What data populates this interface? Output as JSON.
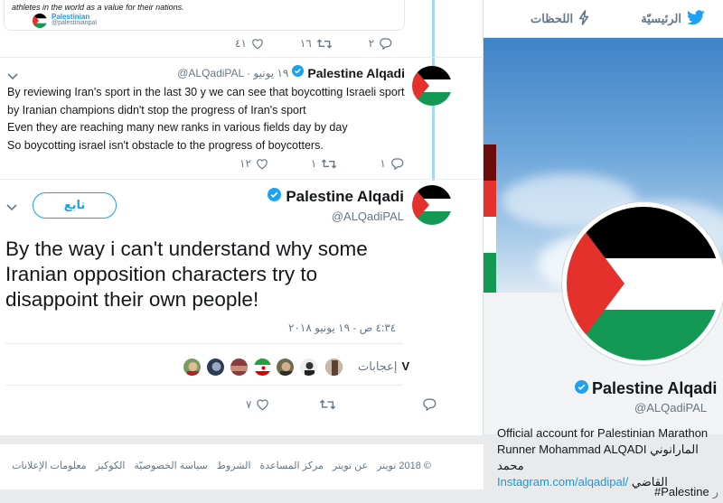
{
  "nav": {
    "home_label": "الرئيسيّة",
    "notifications_label": "اللحظات"
  },
  "quoted_tweet": {
    "text": "athletes in the world as a value for their nations.",
    "author": "Palestinian",
    "handle": "@palestinianpal"
  },
  "tweet1_actions": {
    "replies": "٢",
    "retweets": "١٦",
    "likes": "٤١"
  },
  "tweet2": {
    "name": "Palestine Alqadi",
    "meta": "@ALQadiPAL · ١٩ يونيو",
    "lines": [
      "By reviewing Iran's sport in the last 30 y we can see that boycotting Israeli sport",
      "by Iranian champions didn't stop the progress of Iran's sport",
      "Even they are reaching many new ranks in various fields day by day",
      "So boycotting israel isn't obstacle to the progress of boycotters."
    ],
    "actions": {
      "replies": "١",
      "retweets": "١",
      "likes": "١٢"
    }
  },
  "tweet3": {
    "name": "Palestine Alqadi",
    "handle": "@ALQadiPAL",
    "follow_label": "تابع",
    "text": "By the way i can't understand why some Iranian opposition characters try to disappoint their own people!",
    "timestamp": "٤:٣٤ ص - ١٩ يونيو ٢٠١٨",
    "likes_count": "V",
    "likes_label": "إعجابات",
    "actions": {
      "likes": "٧"
    }
  },
  "footer": {
    "links": [
      "© 2018 تويتر",
      "عن تويتر",
      "مركز المساعدة",
      "الشروط",
      "سياسة الخصوصيّة",
      "الكوكيز",
      "معلومات الإعلانات"
    ]
  },
  "profile": {
    "name": "Palestine Alqadi",
    "handle": "@ALQadiPAL",
    "bio_line1": "Official account for Palestinian Marathon",
    "bio_line2": "Runner Mohammad ALQADI المارانوني محمد",
    "bio_line3_text": "القاضي",
    "bio_link": "Instagram.com/alqadipal/",
    "hashtag": "#Palestine",
    "hashtag_suffix": "ر"
  },
  "colors": {
    "twitter_blue": "#1da1f2",
    "link_blue": "#1b95e0",
    "muted": "#657786",
    "flag_red": "#e4312b",
    "flag_green": "#149954",
    "flag_black": "#000000"
  },
  "icons": [
    "twitter-bird-icon",
    "bolt-icon",
    "verified-icon",
    "chevron-down-icon",
    "reply-icon",
    "retweet-icon",
    "heart-icon"
  ]
}
